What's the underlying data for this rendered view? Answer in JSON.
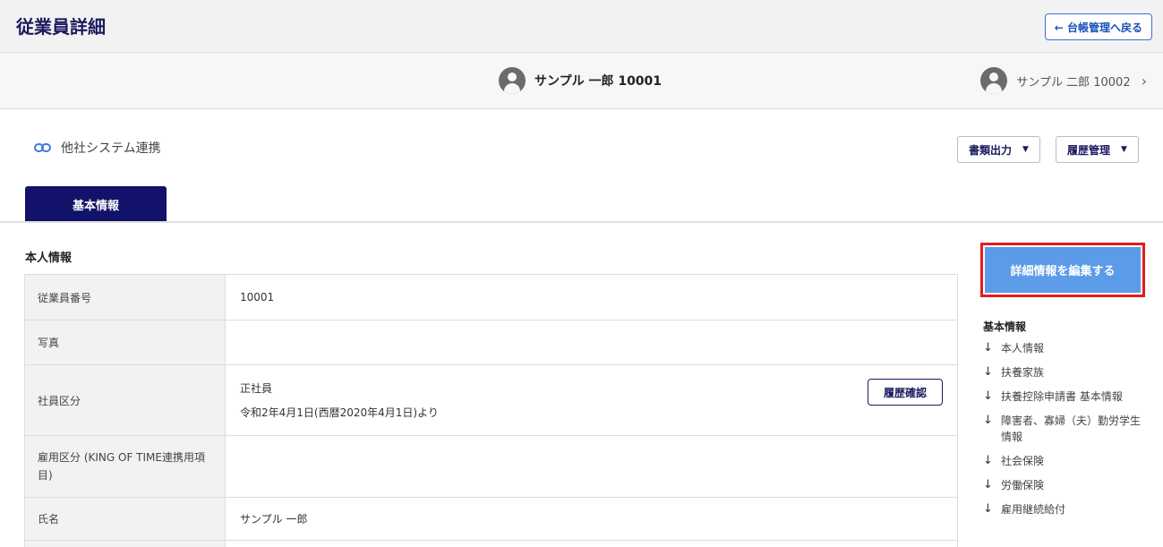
{
  "header": {
    "title": "従業員詳細",
    "back_label": "← 台帳管理へ戻る"
  },
  "employee_nav": {
    "current": "サンプル 一郎 10001",
    "next": "サンプル 二郎 10002"
  },
  "integration_link": "他社システム連携",
  "toolbar": {
    "documents_label": "書類出力",
    "history_label": "履歴管理"
  },
  "tabs": [
    {
      "label": "基本情報",
      "active": true
    }
  ],
  "section": {
    "title": "本人情報",
    "rows": [
      {
        "label": "従業員番号",
        "value": "10001"
      },
      {
        "label": "写真",
        "value": ""
      },
      {
        "label": "社員区分",
        "value": "正社員",
        "sub": "令和2年4月1日(西暦2020年4月1日)より",
        "button": "履歴確認"
      },
      {
        "label": "雇用区分 (KING OF TIME連携用項目)",
        "value": ""
      },
      {
        "label": "氏名",
        "value": "サンプル 一郎"
      }
    ]
  },
  "sidebar": {
    "edit_button": "詳細情報を編集する",
    "heading": "基本情報",
    "items": [
      "本人情報",
      "扶養家族",
      "扶養控除申請書 基本情報",
      "障害者、寡婦（夫）勤労学生情報",
      "社会保険",
      "労働保険",
      "雇用継続給付"
    ]
  },
  "colors": {
    "tab_active": "#12126b",
    "edit_button": "#5c9be8",
    "highlight_border": "#e31d1d",
    "title_text": "#1a1a5e"
  }
}
